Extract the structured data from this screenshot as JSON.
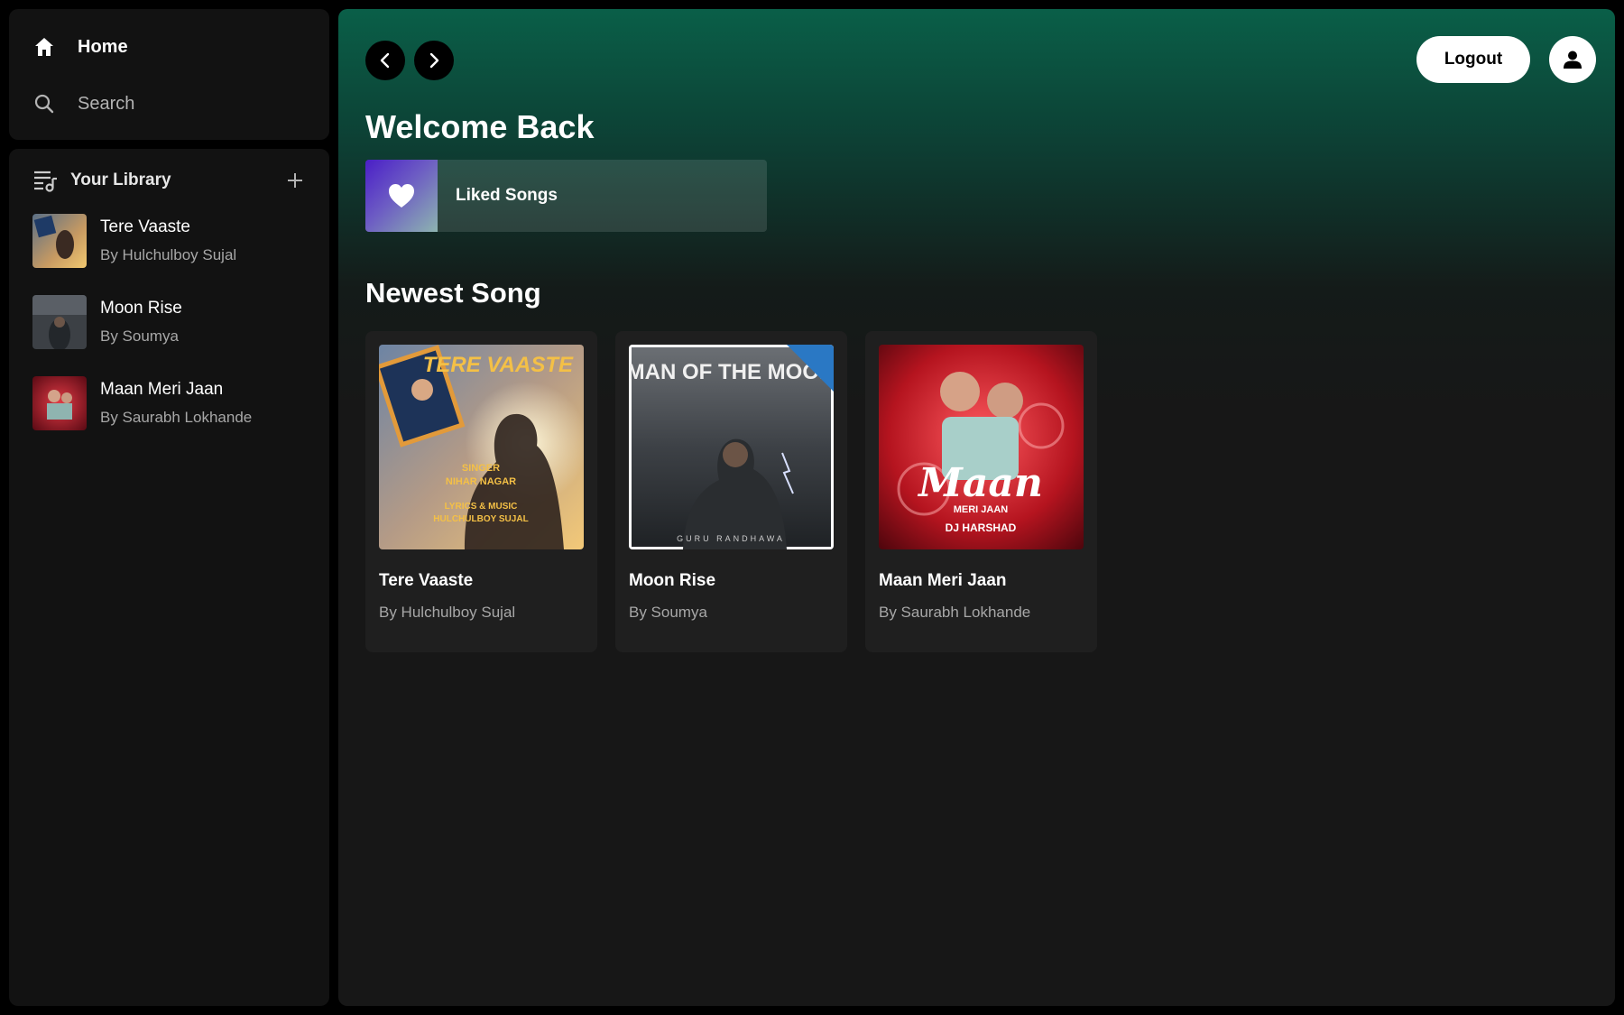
{
  "sidebar": {
    "nav": [
      {
        "label": "Home",
        "icon": "home-icon"
      },
      {
        "label": "Search",
        "icon": "search-icon"
      }
    ],
    "library": {
      "title": "Your Library",
      "items": [
        {
          "name": "Tere Vaaste",
          "artist": "By Hulchulboy Sujal"
        },
        {
          "name": "Moon Rise",
          "artist": "By Soumya"
        },
        {
          "name": "Maan Meri Jaan",
          "artist": "By Saurabh Lokhande"
        }
      ]
    }
  },
  "header": {
    "logout_label": "Logout"
  },
  "main": {
    "welcome": "Welcome Back",
    "liked_songs_label": "Liked Songs",
    "section_title": "Newest Song",
    "songs": [
      {
        "name": "Tere Vaaste",
        "artist": "By Hulchulboy Sujal",
        "cover_text": "TERE VAASTE",
        "cover_lines": [
          "SINGER",
          "NIHAR NAGAR",
          "LYRICS & MUSIC",
          "HULCHULBOY SUJAL"
        ]
      },
      {
        "name": "Moon Rise",
        "artist": "By Soumya",
        "cover_text": "MAN OF THE MOON",
        "cover_lines": [
          "GURU RANDHAWA"
        ]
      },
      {
        "name": "Maan Meri Jaan",
        "artist": "By Saurabh Lokhande",
        "cover_text": "Maan",
        "cover_lines": [
          "MERI JAAN",
          "DJ HARSHAD"
        ]
      }
    ]
  },
  "colors": {
    "accent_green": "#0a5f48",
    "background": "#121212",
    "card": "#1f1f1f",
    "muted_text": "#a7a7a7"
  }
}
